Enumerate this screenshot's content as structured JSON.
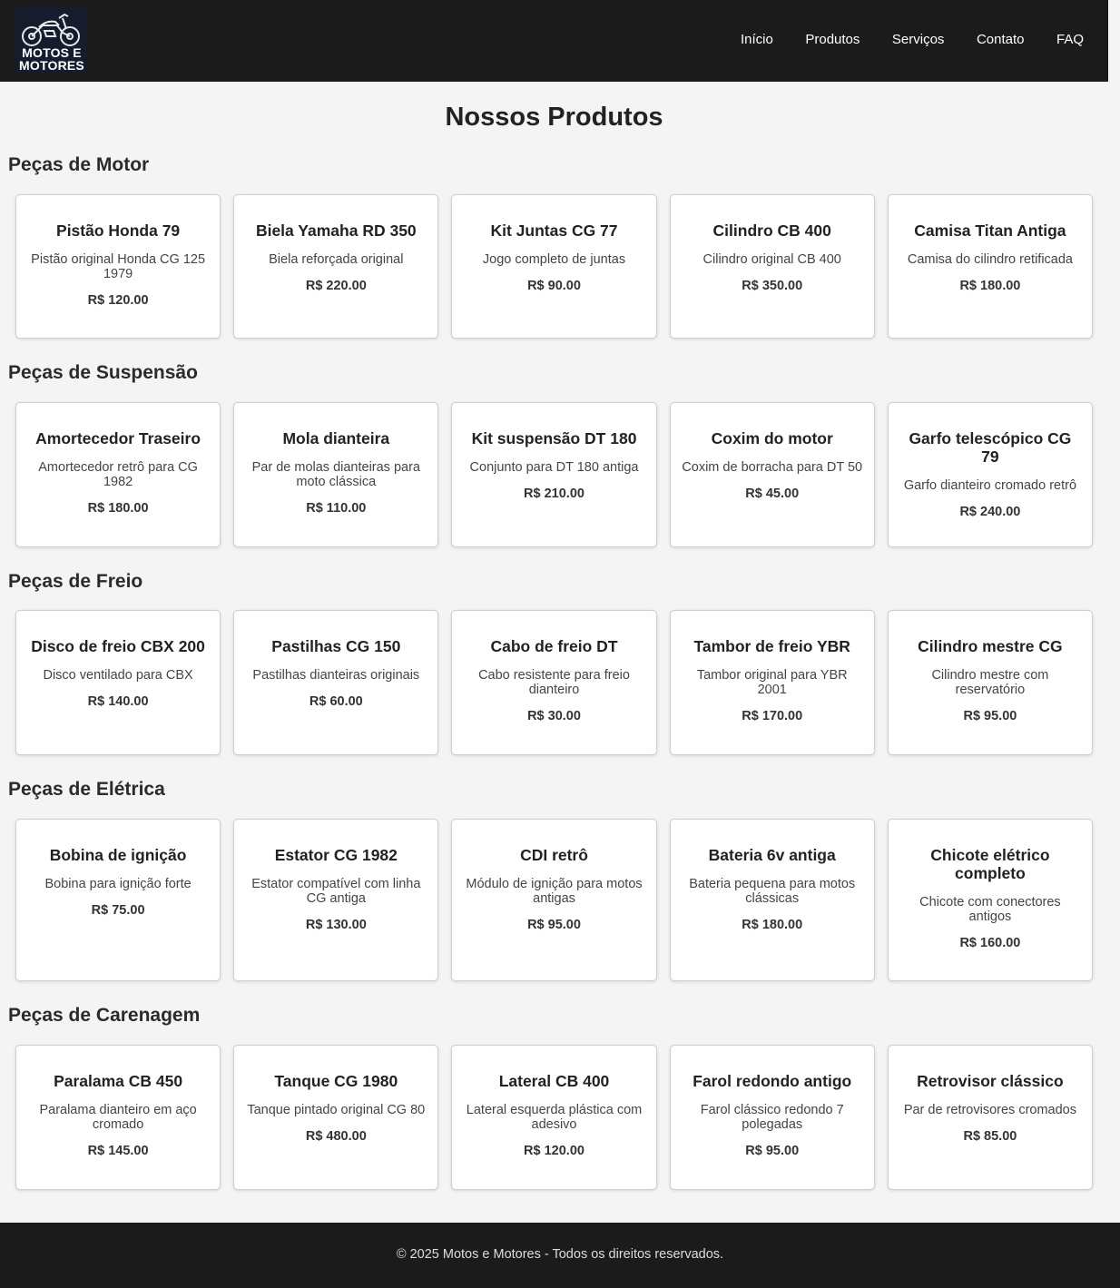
{
  "brand": {
    "logo_line1": "MOTOS E",
    "logo_line2": "MOTORES",
    "logo_icon": "motorcycle-icon"
  },
  "nav": {
    "items": [
      {
        "label": "Início"
      },
      {
        "label": "Produtos"
      },
      {
        "label": "Serviços"
      },
      {
        "label": "Contato"
      },
      {
        "label": "FAQ"
      }
    ]
  },
  "page": {
    "title": "Nossos Produtos"
  },
  "sections": [
    {
      "title": "Peças de Motor",
      "products": [
        {
          "name": "Pistão Honda 79",
          "desc": "Pistão original Honda CG 125 1979",
          "price": "R$ 120.00"
        },
        {
          "name": "Biela Yamaha RD 350",
          "desc": "Biela reforçada original",
          "price": "R$ 220.00"
        },
        {
          "name": "Kit Juntas CG 77",
          "desc": "Jogo completo de juntas",
          "price": "R$ 90.00"
        },
        {
          "name": "Cilindro CB 400",
          "desc": "Cilindro original CB 400",
          "price": "R$ 350.00"
        },
        {
          "name": "Camisa Titan Antiga",
          "desc": "Camisa do cilindro retificada",
          "price": "R$ 180.00"
        }
      ]
    },
    {
      "title": "Peças de Suspensão",
      "products": [
        {
          "name": "Amortecedor Traseiro",
          "desc": "Amortecedor retrô para CG 1982",
          "price": "R$ 180.00"
        },
        {
          "name": "Mola dianteira",
          "desc": "Par de molas dianteiras para moto clássica",
          "price": "R$ 110.00"
        },
        {
          "name": "Kit suspensão DT 180",
          "desc": "Conjunto para DT 180 antiga",
          "price": "R$ 210.00"
        },
        {
          "name": "Coxim do motor",
          "desc": "Coxim de borracha para DT 50",
          "price": "R$ 45.00"
        },
        {
          "name": "Garfo telescópico CG 79",
          "desc": "Garfo dianteiro cromado retrô",
          "price": "R$ 240.00"
        }
      ]
    },
    {
      "title": "Peças de Freio",
      "products": [
        {
          "name": "Disco de freio CBX 200",
          "desc": "Disco ventilado para CBX",
          "price": "R$ 140.00"
        },
        {
          "name": "Pastilhas CG 150",
          "desc": "Pastilhas dianteiras originais",
          "price": "R$ 60.00"
        },
        {
          "name": "Cabo de freio DT",
          "desc": "Cabo resistente para freio dianteiro",
          "price": "R$ 30.00"
        },
        {
          "name": "Tambor de freio YBR",
          "desc": "Tambor original para YBR 2001",
          "price": "R$ 170.00"
        },
        {
          "name": "Cilindro mestre CG",
          "desc": "Cilindro mestre com reservatório",
          "price": "R$ 95.00"
        }
      ]
    },
    {
      "title": "Peças de Elétrica",
      "products": [
        {
          "name": "Bobina de ignição",
          "desc": "Bobina para ignição forte",
          "price": "R$ 75.00"
        },
        {
          "name": "Estator CG 1982",
          "desc": "Estator compatível com linha CG antiga",
          "price": "R$ 130.00"
        },
        {
          "name": "CDI retrô",
          "desc": "Módulo de ignição para motos antigas",
          "price": "R$ 95.00"
        },
        {
          "name": "Bateria 6v antiga",
          "desc": "Bateria pequena para motos clássicas",
          "price": "R$ 180.00"
        },
        {
          "name": "Chicote elétrico completo",
          "desc": "Chicote com conectores antigos",
          "price": "R$ 160.00"
        }
      ]
    },
    {
      "title": "Peças de Carenagem",
      "products": [
        {
          "name": "Paralama CB 450",
          "desc": "Paralama dianteiro em aço cromado",
          "price": "R$ 145.00"
        },
        {
          "name": "Tanque CG 1980",
          "desc": "Tanque pintado original CG 80",
          "price": "R$ 480.00"
        },
        {
          "name": "Lateral CB 400",
          "desc": "Lateral esquerda plástica com adesivo",
          "price": "R$ 120.00"
        },
        {
          "name": "Farol redondo antigo",
          "desc": "Farol clássico redondo 7 polegadas",
          "price": "R$ 95.00"
        },
        {
          "name": "Retrovisor clássico",
          "desc": "Par de retrovisores cromados",
          "price": "R$ 85.00"
        }
      ]
    }
  ],
  "footer": {
    "text": "© 2025 Motos e Motores - Todos os direitos reservados."
  },
  "colors": {
    "header_bg": "#1b1b1b",
    "page_bg": "#f4f4f4",
    "card_bg": "#ffffff",
    "logo_bg": "#141c2e"
  }
}
